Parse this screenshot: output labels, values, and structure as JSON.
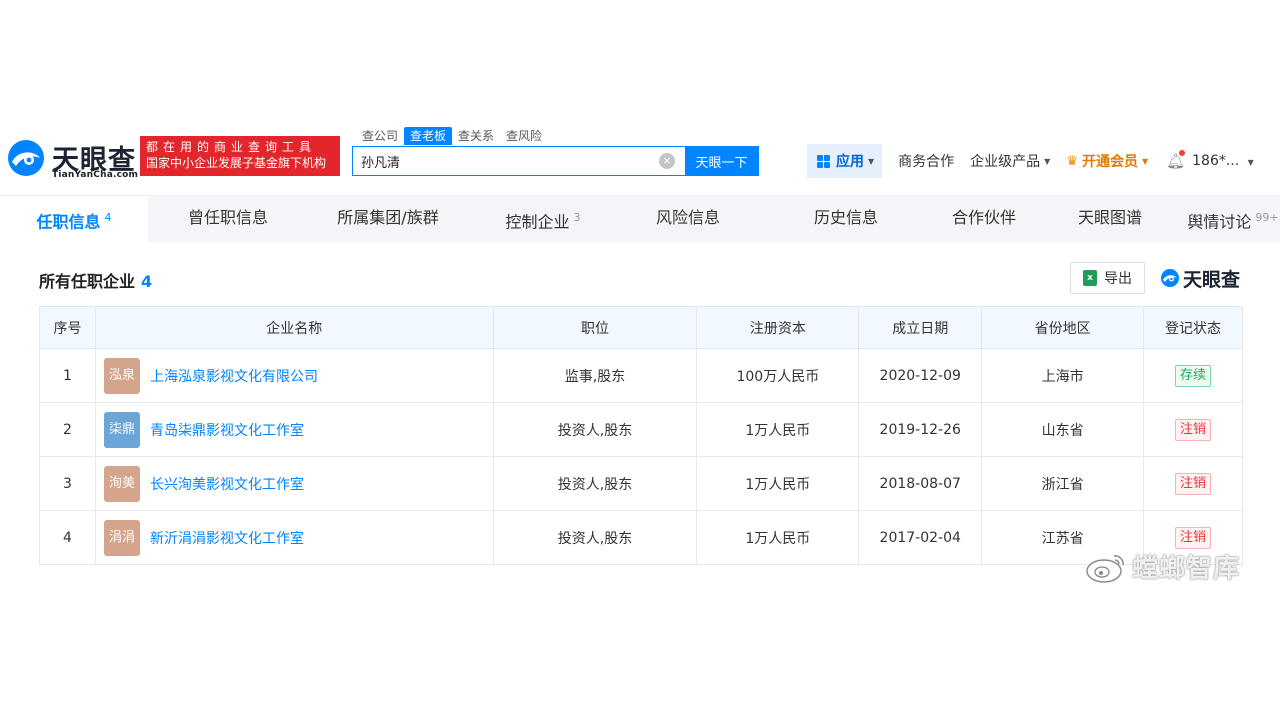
{
  "brand": {
    "name_cn": "天眼查",
    "name_en": "TianYanCha.com",
    "slogan_line1": "都在用的商业查询工具",
    "slogan_line2": "国家中小企业发展子基金旗下机构"
  },
  "search": {
    "tabs": [
      {
        "label": "查公司",
        "active": false
      },
      {
        "label": "查老板",
        "active": true
      },
      {
        "label": "查关系",
        "active": false
      },
      {
        "label": "查风险",
        "active": false
      }
    ],
    "value": "孙凡清",
    "clear_glyph": "×",
    "button_label": "天眼一下"
  },
  "nav": {
    "apps_label": "应用",
    "items": [
      "商务合作",
      "企业级产品"
    ],
    "vip_label": "开通会员",
    "user_label": "186*..."
  },
  "tabs": [
    {
      "label": "任职信息",
      "count": "4",
      "active": true
    },
    {
      "label": "曾任职信息",
      "count": "",
      "active": false
    },
    {
      "label": "所属集团/族群",
      "count": "",
      "active": false
    },
    {
      "label": "控制企业",
      "count": "3",
      "active": false
    },
    {
      "label": "风险信息",
      "count": "",
      "active": false
    },
    {
      "label": "历史信息",
      "count": "",
      "active": false
    },
    {
      "label": "合作伙伴",
      "count": "",
      "active": false
    },
    {
      "label": "天眼图谱",
      "count": "",
      "active": false
    },
    {
      "label": "舆情讨论",
      "count": "99+",
      "active": false
    }
  ],
  "section": {
    "title": "所有任职企业",
    "count": "4",
    "export_label": "导出",
    "brand_label": "天眼查"
  },
  "table": {
    "headers": [
      "序号",
      "企业名称",
      "职位",
      "注册资本",
      "成立日期",
      "省份地区",
      "登记状态"
    ],
    "rows": [
      {
        "index": "1",
        "logo_text": "泓泉",
        "logo_color": "#d4a58c",
        "name": "上海泓泉影视文化有限公司",
        "position": "监事,股东",
        "capital": "100万人民币",
        "date": "2020-12-09",
        "region": "上海市",
        "status": "存续",
        "status_type": "ok"
      },
      {
        "index": "2",
        "logo_text": "柒鼎",
        "logo_color": "#6aa6d8",
        "name": "青岛柒鼎影视文化工作室",
        "position": "投资人,股东",
        "capital": "1万人民币",
        "date": "2019-12-26",
        "region": "山东省",
        "status": "注销",
        "status_type": "no"
      },
      {
        "index": "3",
        "logo_text": "洵美",
        "logo_color": "#d4a58c",
        "name": "长兴洵美影视文化工作室",
        "position": "投资人,股东",
        "capital": "1万人民币",
        "date": "2018-08-07",
        "region": "浙江省",
        "status": "注销",
        "status_type": "no"
      },
      {
        "index": "4",
        "logo_text": "涓涓",
        "logo_color": "#d4a58c",
        "name": "新沂涓涓影视文化工作室",
        "position": "投资人,股东",
        "capital": "1万人民币",
        "date": "2017-02-04",
        "region": "江苏省",
        "status": "注销",
        "status_type": "no"
      }
    ]
  },
  "watermark": "螳螂智库",
  "colors": {
    "accent": "#0084ff",
    "slogan_bg": "#e2262b",
    "vip": "#e07b00"
  }
}
